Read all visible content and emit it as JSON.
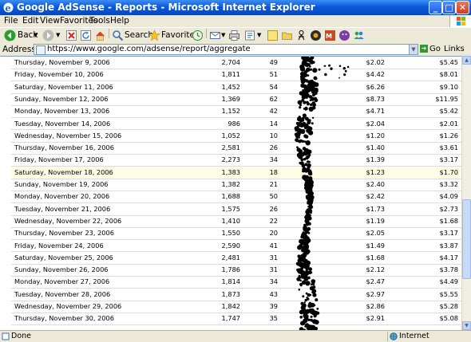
{
  "window": {
    "title": "Google AdSense - Reports - Microsoft Internet Explorer"
  },
  "menu": [
    "File",
    "Edit",
    "View",
    "Favorites",
    "Tools",
    "Help"
  ],
  "toolbar": {
    "back": "Back",
    "search": "Search",
    "favorites": "Favorites"
  },
  "address": {
    "label": "Address",
    "url": "https://www.google.com/adsense/report/aggregate",
    "go": "Go",
    "links": "Links"
  },
  "status": {
    "text": "Done",
    "zone": "Internet"
  },
  "report": {
    "rows": [
      {
        "date": "Thursday, November 9, 2006",
        "c1": "2,704",
        "c2": "49",
        "c3": "$2.02",
        "c4": "$5.45"
      },
      {
        "date": "Friday, November 10, 2006",
        "c1": "1,811",
        "c2": "51",
        "c3": "$4.42",
        "c4": "$8.01"
      },
      {
        "date": "Saturday, November 11, 2006",
        "c1": "1,452",
        "c2": "54",
        "c3": "$6.26",
        "c4": "$9.10"
      },
      {
        "date": "Sunday, November 12, 2006",
        "c1": "1,369",
        "c2": "62",
        "c3": "$8.73",
        "c4": "$11.95"
      },
      {
        "date": "Monday, November 13, 2006",
        "c1": "1,152",
        "c2": "42",
        "c3": "$4.71",
        "c4": "$5.42"
      },
      {
        "date": "Tuesday, November 14, 2006",
        "c1": "986",
        "c2": "14",
        "c3": "$2.04",
        "c4": "$2.01"
      },
      {
        "date": "Wednesday, November 15, 2006",
        "c1": "1,052",
        "c2": "10",
        "c3": "$1.20",
        "c4": "$1.26"
      },
      {
        "date": "Thursday, November 16, 2006",
        "c1": "2,581",
        "c2": "26",
        "c3": "$1.40",
        "c4": "$3.61"
      },
      {
        "date": "Friday, November 17, 2006",
        "c1": "2,273",
        "c2": "34",
        "c3": "$1.39",
        "c4": "$3.17"
      },
      {
        "date": "Saturday, November 18, 2006",
        "c1": "1,383",
        "c2": "18",
        "c3": "$1.23",
        "c4": "$1.70"
      },
      {
        "date": "Sunday, November 19, 2006",
        "c1": "1,382",
        "c2": "21",
        "c3": "$2.40",
        "c4": "$3.32"
      },
      {
        "date": "Monday, November 20, 2006",
        "c1": "1,688",
        "c2": "50",
        "c3": "$2.42",
        "c4": "$4.09"
      },
      {
        "date": "Tuesday, November 21, 2006",
        "c1": "1,575",
        "c2": "26",
        "c3": "$1.73",
        "c4": "$2.73"
      },
      {
        "date": "Wednesday, November 22, 2006",
        "c1": "1,410",
        "c2": "22",
        "c3": "$1.19",
        "c4": "$1.68"
      },
      {
        "date": "Thursday, November 23, 2006",
        "c1": "1,550",
        "c2": "20",
        "c3": "$2.05",
        "c4": "$3.17"
      },
      {
        "date": "Friday, November 24, 2006",
        "c1": "2,590",
        "c2": "41",
        "c3": "$1.49",
        "c4": "$3.87"
      },
      {
        "date": "Saturday, November 25, 2006",
        "c1": "2,481",
        "c2": "31",
        "c3": "$1.68",
        "c4": "$4.17"
      },
      {
        "date": "Sunday, November 26, 2006",
        "c1": "1,786",
        "c2": "31",
        "c3": "$2.12",
        "c4": "$3.78"
      },
      {
        "date": "Monday, November 27, 2006",
        "c1": "1,814",
        "c2": "34",
        "c3": "$2.47",
        "c4": "$4.49"
      },
      {
        "date": "Tuesday, November 28, 2006",
        "c1": "1,873",
        "c2": "43",
        "c3": "$2.97",
        "c4": "$5.55"
      },
      {
        "date": "Wednesday, November 29, 2006",
        "c1": "1,842",
        "c2": "39",
        "c3": "$2.86",
        "c4": "$5.28"
      },
      {
        "date": "Thursday, November 30, 2006",
        "c1": "1,747",
        "c2": "35",
        "c3": "$2.91",
        "c4": "$5.08"
      }
    ],
    "highlighted_row": 9
  }
}
